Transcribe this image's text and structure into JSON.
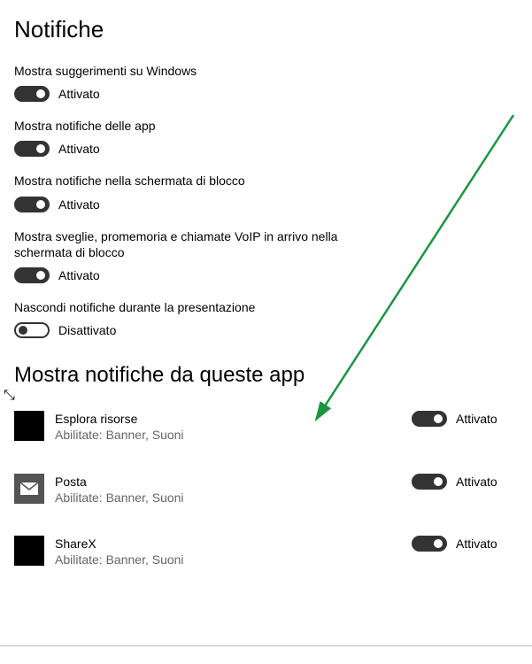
{
  "heading": "Notifiche",
  "settings": [
    {
      "label": "Mostra suggerimenti su Windows",
      "state": "Attivato",
      "on": true
    },
    {
      "label": "Mostra notifiche delle app",
      "state": "Attivato",
      "on": true
    },
    {
      "label": "Mostra notifiche nella schermata di blocco",
      "state": "Attivato",
      "on": true
    },
    {
      "label": "Mostra sveglie, promemoria e chiamate VoIP in arrivo nella schermata di blocco",
      "state": "Attivato",
      "on": true
    },
    {
      "label": "Nascondi notifiche durante la presentazione",
      "state": "Disattivato",
      "on": false
    }
  ],
  "appsHeading": "Mostra notifiche da queste app",
  "apps": [
    {
      "name": "Esplora risorse",
      "sub": "Abilitate: Banner, Suoni",
      "state": "Attivato",
      "icon": "black"
    },
    {
      "name": "Posta",
      "sub": "Abilitate: Banner, Suoni",
      "state": "Attivato",
      "icon": "mail"
    },
    {
      "name": "ShareX",
      "sub": "Abilitate: Banner, Suoni",
      "state": "Attivato",
      "icon": "black"
    }
  ]
}
